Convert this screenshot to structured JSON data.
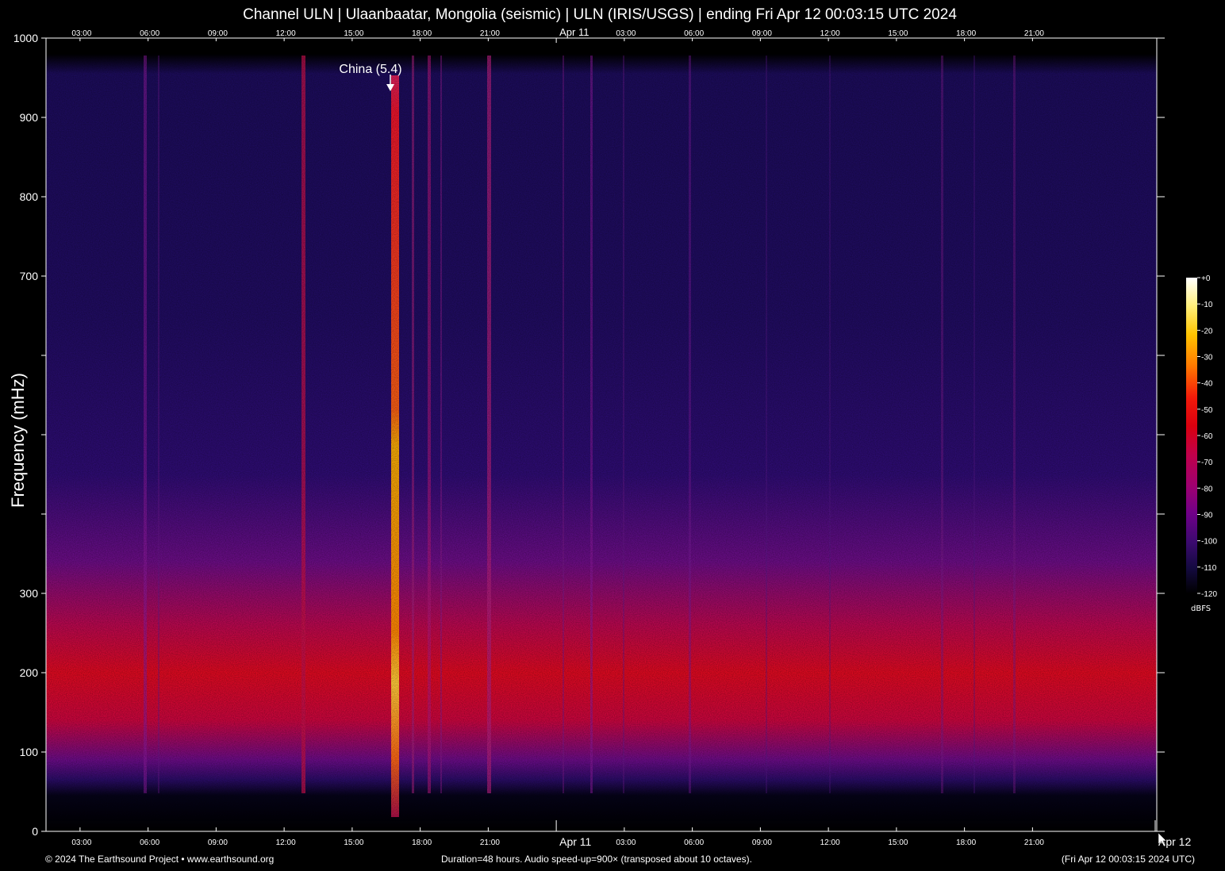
{
  "chart_data": {
    "type": "heatmap",
    "title": "Channel ULN | Ulaanbaatar, Mongolia (seismic) | ULN (IRIS/USGS) | ending Fri Apr 12 00:03:15 UTC 2024",
    "ylabel": "Frequency (mHz)",
    "ylim": [
      0,
      1000
    ],
    "y_ticks": [
      0,
      100,
      200,
      300,
      400,
      500,
      600,
      700,
      800,
      900,
      1000
    ],
    "y_tick_labels": [
      "0",
      "100",
      "200",
      "300",
      "",
      "",
      "",
      "700",
      "800",
      "900",
      "1000"
    ],
    "x_tick_labels": [
      "03:00",
      "06:00",
      "09:00",
      "12:00",
      "15:00",
      "18:00",
      "21:00",
      "Apr 11",
      "03:00",
      "06:00",
      "09:00",
      "12:00",
      "15:00",
      "18:00",
      "21:00"
    ],
    "x_end_label": "Apr 12",
    "duration_hours": 48,
    "colorbar": {
      "unit": "dBFS",
      "ticks": [
        "+0",
        "-10",
        "-20",
        "-30",
        "-40",
        "-50",
        "-60",
        "-70",
        "-80",
        "-90",
        "-100",
        "-110",
        "-120"
      ],
      "colors": [
        "#ffffff",
        "#ffef7a",
        "#ffc400",
        "#ff7800",
        "#f21a0a",
        "#d9000f",
        "#c0004a",
        "#9e0070",
        "#6e0088",
        "#3a0a6e",
        "#140a40",
        "#06051a",
        "#000000"
      ]
    },
    "annotation": {
      "label": "China (5.4)",
      "frequency_mhz": 935
    },
    "energy_band_mhz": [
      150,
      250
    ]
  },
  "footer": {
    "copyright": "© 2024 The Earthsound Project • www.earthsound.org",
    "info": "Duration=48 hours. Audio speed-up=900× (transposed about 10 octaves).",
    "timestamp": "(Fri Apr 12 00:03:15 2024 UTC)"
  }
}
